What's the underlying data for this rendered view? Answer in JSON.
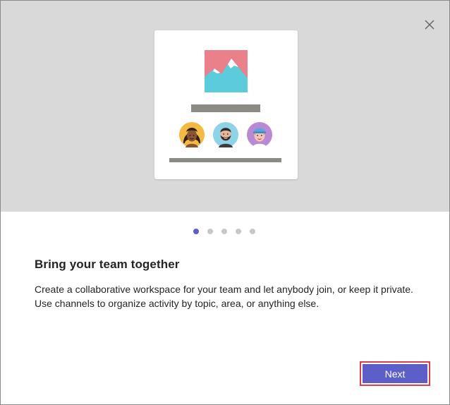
{
  "dialog": {
    "close_icon": "close-icon",
    "illustration": {
      "icons": [
        "picture-icon",
        "avatar-woman-icon",
        "avatar-man-beard-icon",
        "avatar-man-cap-icon"
      ]
    },
    "pager": {
      "total": 5,
      "current": 1
    },
    "heading": "Bring your team together",
    "body": "Create a collaborative workspace for your team and let anybody join, or keep it private. Use channels to organize activity by topic, area, or anything else.",
    "next_label": "Next"
  },
  "colors": {
    "accent": "#5b5fc7",
    "hero_background": "#d9d9d9",
    "highlight_border": "#e03a4e"
  }
}
